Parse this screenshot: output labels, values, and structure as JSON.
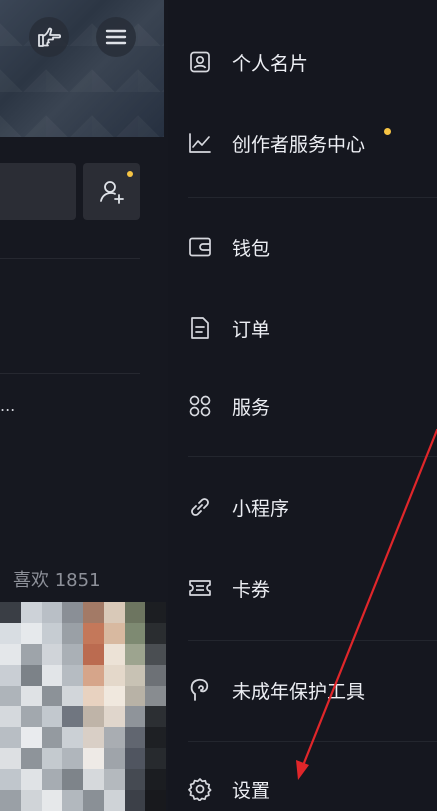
{
  "background_page": {
    "stats": {
      "likes_label": "喜欢 1851"
    },
    "ellipsis": "..."
  },
  "menu": {
    "items": [
      {
        "label": "个人名片",
        "icon": "profile-card-icon"
      },
      {
        "label": "创作者服务中心",
        "icon": "chart-line-icon",
        "has_dot": true
      },
      {
        "label": "钱包",
        "icon": "wallet-icon"
      },
      {
        "label": "订单",
        "icon": "order-icon"
      },
      {
        "label": "服务",
        "icon": "services-grid-icon"
      },
      {
        "label": "小程序",
        "icon": "mini-program-icon"
      },
      {
        "label": "卡券",
        "icon": "coupon-icon"
      },
      {
        "label": "未成年保护工具",
        "icon": "minor-protection-icon"
      },
      {
        "label": "设置",
        "icon": "settings-gear-icon"
      }
    ]
  },
  "colors": {
    "background": "#15171f",
    "text": "#eceef3",
    "notification_dot": "#f6c444",
    "annotation_arrow": "#e0262a"
  }
}
